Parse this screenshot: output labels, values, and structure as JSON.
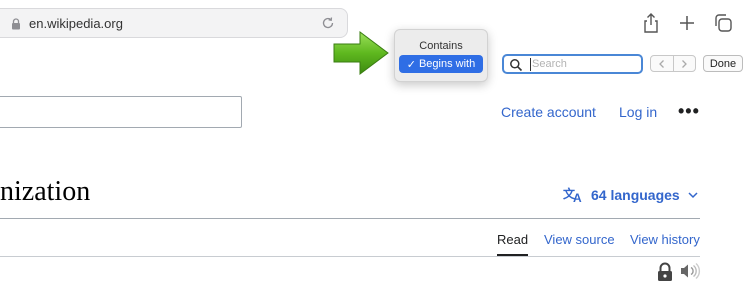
{
  "browser": {
    "url": "en.wikipedia.org"
  },
  "find_bar": {
    "search_placeholder": "Search",
    "done_label": "Done",
    "menu": {
      "contains_label": "Contains",
      "begins_with_label": "Begins with",
      "selected": "Begins with"
    }
  },
  "wiki": {
    "create_account": "Create account",
    "log_in": "Log in",
    "more": "•••",
    "title": "nization",
    "languages": "64 languages",
    "tabs": {
      "read": "Read",
      "view_source": "View source",
      "view_history": "View history"
    }
  },
  "colors": {
    "link": "#3366cc",
    "accent": "#2f6ee5",
    "arrow": "#5fb81f"
  }
}
